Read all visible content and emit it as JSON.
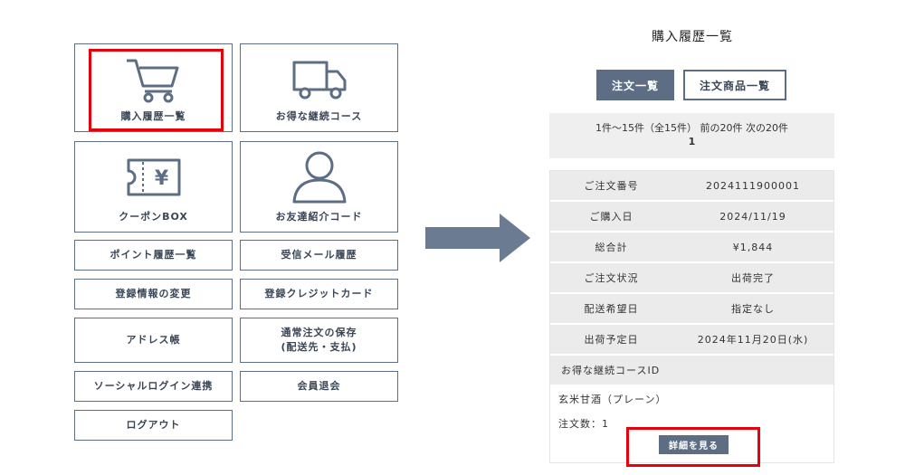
{
  "menu": {
    "purchase_history": "購入履歴一覧",
    "subscription_course": "お得な継続コース",
    "coupon_box": "クーポンBOX",
    "friend_referral": "お友達紹介コード",
    "point_history": "ポイント履歴一覧",
    "received_mail": "受信メール履歴",
    "change_registration": "登録情報の変更",
    "registered_card": "登録クレジットカード",
    "address_book": "アドレス帳",
    "save_order_line1": "通常注文の保存",
    "save_order_line2": "(配送先・支払)",
    "social_login": "ソーシャルログイン連携",
    "withdraw": "会員退会",
    "logout": "ログアウト"
  },
  "colors": {
    "accent": "#5d6d84",
    "highlight": "#e8000b",
    "row_bg": "#ebebeb"
  },
  "history": {
    "title": "購入履歴一覧",
    "tabs": {
      "orders": "注文一覧",
      "items": "注文商品一覧"
    },
    "pager": {
      "summary": "1件～15件（全15件） 前の20件 次の20件",
      "page": "1"
    },
    "order": {
      "rows": [
        {
          "key": "ご注文番号",
          "value": "2024111900001"
        },
        {
          "key": "ご購入日",
          "value": "2024/11/19"
        },
        {
          "key": "総合計",
          "value": "¥1,844"
        },
        {
          "key": "ご注文状況",
          "value": "出荷完了"
        },
        {
          "key": "配送希望日",
          "value": "指定なし"
        },
        {
          "key": "出荷予定日",
          "value": "2024年11月20日(水)"
        }
      ],
      "course_label": "お得な継続コースID",
      "course_name": "玄米甘酒（プレーン）",
      "order_count": "注文数：1",
      "detail_button": "詳細を見る"
    }
  }
}
